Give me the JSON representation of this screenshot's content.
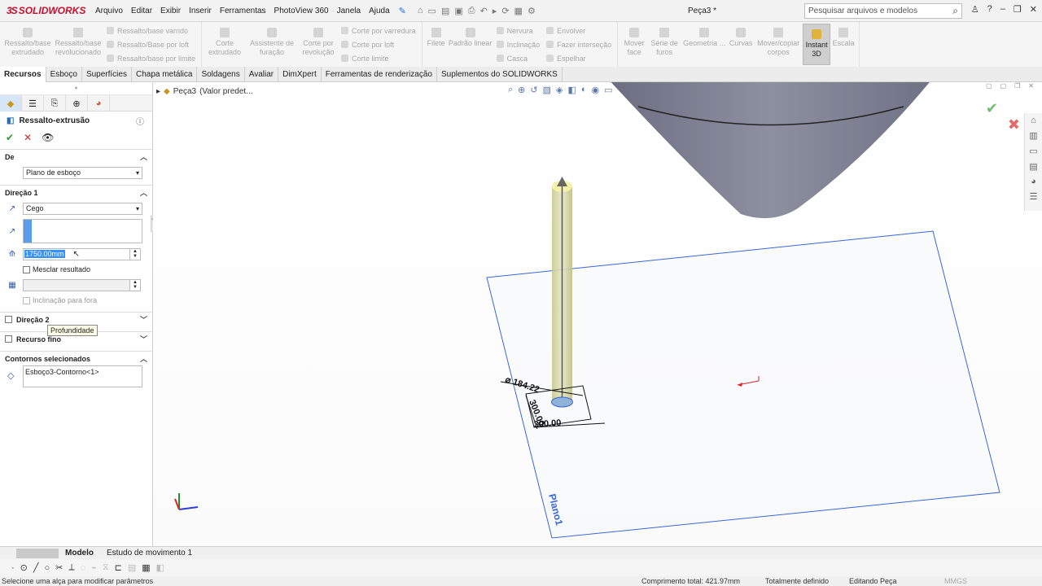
{
  "app": {
    "brand": "SOLIDWORKS",
    "brand_prefix": "3S",
    "document_title": "Peça3 *"
  },
  "menu": [
    "Arquivo",
    "Editar",
    "Exibir",
    "Inserir",
    "Ferramentas",
    "PhotoView 360",
    "Janela",
    "Ajuda"
  ],
  "search": {
    "placeholder": "Pesquisar arquivos e modelos"
  },
  "ribbon": {
    "extrude_boss": "Ressalto/base extrudado",
    "revolve_boss": "Ressalto/base revolucionado",
    "swept_boss": "Ressalto/base varrido",
    "lofted_boss": "Ressalto/Base por loft",
    "boundary_boss": "Ressalto/base por limite",
    "extruded_cut": "Corte extrudado",
    "hole_wizard": "Assistente de furação",
    "revolved_cut": "Corte por revolução",
    "swept_cut": "Corte por varredura",
    "lofted_cut": "Corte por loft",
    "boundary_cut": "Corte limite",
    "fillet": "Filete",
    "linear_pattern": "Padrão linear",
    "rib": "Nervura",
    "draft": "Inclinação",
    "shell": "Casca",
    "wrap": "Envolver",
    "intersect": "Fazer interseção",
    "mirror": "Espelhar",
    "move_face": "Mover face",
    "hole_series": "Série de furos",
    "ref_geometry": "Geometria ...",
    "curves": "Curvas",
    "move_copy_bodies": "Mover/copiar corpos",
    "instant3d": "Instant 3D",
    "scale": "Escala"
  },
  "cm_tabs": [
    "Recursos",
    "Esboço",
    "Superfícies",
    "Chapa metálica",
    "Soldagens",
    "Avaliar",
    "DimXpert",
    "Ferramentas de renderização",
    "Suplementos do SOLIDWORKS"
  ],
  "panel": {
    "feature_title": "Ressalto-extrusão",
    "from_label": "De",
    "from_value": "Plano de esboço",
    "direction1_label": "Direção 1",
    "end_condition": "Cego",
    "tooltip": "Profundidade",
    "depth_value": "1750.00mm",
    "merge_result": "Mesclar resultado",
    "draft_outward": "Inclinação para fora",
    "direction2_label": "Direção 2",
    "thin_feature": "Recurso fino",
    "selected_contours_label": "Contornos selecionados",
    "selected_contour_item": "Esboço3-Contorno<1>"
  },
  "viewport": {
    "breadcrumb_part": "Peça3",
    "breadcrumb_state": "(Valor predet...",
    "plane_label": "Plano1",
    "dim_diameter": "⌀ 184.22",
    "dim_side": "300.00",
    "dim_bottom": "300.00"
  },
  "bottom_tabs": [
    "Modelo",
    "Estudo de movimento 1"
  ],
  "status": {
    "message": "Selecione uma alça para modificar parâmetros",
    "total_length": "Comprimento total: 421.97mm",
    "definition": "Totalmente definido",
    "editing": "Editando Peça",
    "units": "MMGS"
  },
  "colors": {
    "plane_blue": "#3a66d6",
    "cone_gray": "#7f8293",
    "cylinder_yellow": "#d6d7a6",
    "brand_red": "#c8102e"
  }
}
